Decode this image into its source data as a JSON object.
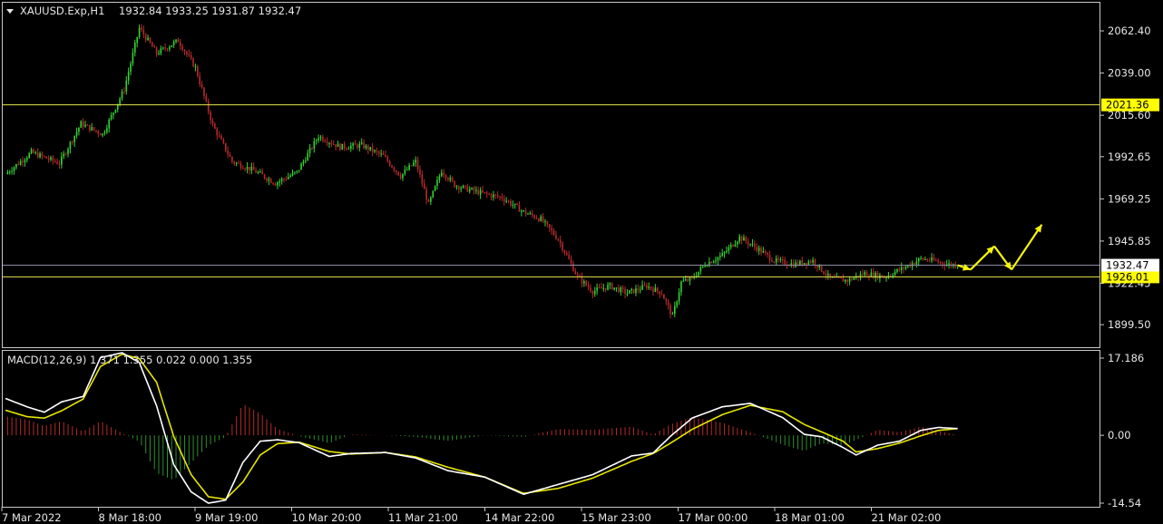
{
  "header": {
    "dropdown_icon": "triangle-down-icon",
    "symbol": "XAUUSD.Exp,H1",
    "ohlc": "1932.84 1933.25 1931.87 1932.47"
  },
  "macd": {
    "label": "MACD(12,26,9) 1.371 1.355 0.022 0.000 1.355"
  },
  "colors": {
    "background": "#000000",
    "frame": "#c8c8c8",
    "bull_candle": "#35d335",
    "bear_candle": "#b52a2a",
    "level_line": "#e6e64d",
    "level_label_bg": "#ffff00",
    "price_line": "#8a8aa0",
    "macd_line": "#ffffff",
    "signal_line": "#e6e600",
    "forecast_arrow": "#f5f50a"
  },
  "chart_data": [
    {
      "type": "candlestick",
      "symbol": "XAUUSD.Exp",
      "timeframe": "H1",
      "ylim": [
        1887,
        2078
      ],
      "y_ticks": [
        "2062.40",
        "2039.00",
        "2015.60",
        "1992.65",
        "1969.25",
        "1945.85",
        "1922.45",
        "1899.50"
      ],
      "x_ticks": [
        "7 Mar 2022",
        "8 Mar 18:00",
        "9 Mar 19:00",
        "10 Mar 20:00",
        "11 Mar 21:00",
        "14 Mar 22:00",
        "15 Mar 23:00",
        "17 Mar 00:00",
        "18 Mar 01:00",
        "21 Mar 02:00"
      ],
      "close_path": [
        [
          0,
          1983
        ],
        [
          12,
          1995
        ],
        [
          25,
          1989
        ],
        [
          35,
          2011
        ],
        [
          45,
          2005
        ],
        [
          55,
          2030
        ],
        [
          62,
          2064
        ],
        [
          70,
          2050
        ],
        [
          80,
          2057
        ],
        [
          88,
          2042
        ],
        [
          96,
          2010
        ],
        [
          105,
          1990
        ],
        [
          115,
          1985
        ],
        [
          125,
          1978
        ],
        [
          135,
          1984
        ],
        [
          145,
          2004
        ],
        [
          155,
          1998
        ],
        [
          165,
          1999
        ],
        [
          175,
          1993
        ],
        [
          183,
          1982
        ],
        [
          190,
          1990
        ],
        [
          196,
          1966
        ],
        [
          202,
          1985
        ],
        [
          208,
          1977
        ],
        [
          213,
          1975
        ],
        [
          222,
          1972
        ],
        [
          230,
          1970
        ],
        [
          240,
          1962
        ],
        [
          248,
          1958
        ],
        [
          256,
          1947
        ],
        [
          265,
          1926
        ],
        [
          272,
          1918
        ],
        [
          280,
          1921
        ],
        [
          288,
          1917
        ],
        [
          297,
          1921
        ],
        [
          304,
          1917
        ],
        [
          309,
          1904
        ],
        [
          313,
          1923
        ],
        [
          318,
          1925
        ],
        [
          324,
          1933
        ],
        [
          332,
          1938
        ],
        [
          340,
          1948
        ],
        [
          348,
          1942
        ],
        [
          356,
          1935
        ],
        [
          365,
          1933
        ],
        [
          374,
          1935
        ],
        [
          382,
          1925
        ],
        [
          390,
          1924
        ],
        [
          398,
          1928
        ],
        [
          407,
          1926
        ],
        [
          416,
          1931
        ],
        [
          424,
          1936
        ],
        [
          430,
          1935
        ],
        [
          436,
          1933
        ],
        [
          441,
          1932.5
        ]
      ],
      "support_levels": [
        "2021.36",
        "1926.01"
      ],
      "current_price": "1932.47",
      "forecast_path": [
        [
          441,
          1932.5
        ],
        [
          447,
          1930
        ],
        [
          458,
          1943
        ],
        [
          466,
          1930
        ],
        [
          480,
          1955
        ]
      ]
    },
    {
      "type": "line",
      "indicator": "MACD",
      "params": [
        12,
        26,
        9
      ],
      "ylim": [
        -14.54,
        17.186
      ],
      "y_ticks": [
        "17.186",
        "0.00",
        "-14.54"
      ],
      "series": [
        {
          "role": "macd",
          "values": [
            [
              0,
              7.5
            ],
            [
              10,
              5.8
            ],
            [
              18,
              4.7
            ],
            [
              26,
              6.8
            ],
            [
              36,
              7.9
            ],
            [
              44,
              15.8
            ],
            [
              54,
              16.8
            ],
            [
              62,
              14.8
            ],
            [
              70,
              6.0
            ],
            [
              78,
              -6.0
            ],
            [
              86,
              -11.5
            ],
            [
              94,
              -13.8
            ],
            [
              102,
              -13.2
            ],
            [
              110,
              -5.5
            ],
            [
              118,
              -1.2
            ],
            [
              126,
              -0.9
            ],
            [
              136,
              -1.5
            ],
            [
              150,
              -4.3
            ],
            [
              160,
              -3.7
            ],
            [
              176,
              -3.5
            ],
            [
              190,
              -4.6
            ],
            [
              205,
              -7.2
            ],
            [
              222,
              -8.5
            ],
            [
              240,
              -12.0
            ],
            [
              256,
              -10.0
            ],
            [
              272,
              -8.0
            ],
            [
              290,
              -4.2
            ],
            [
              300,
              -3.6
            ],
            [
              308,
              -0.2
            ],
            [
              318,
              3.5
            ],
            [
              332,
              5.8
            ],
            [
              345,
              6.5
            ],
            [
              360,
              3.6
            ],
            [
              370,
              0.2
            ],
            [
              378,
              -0.3
            ],
            [
              388,
              -2.5
            ],
            [
              394,
              -4.0
            ],
            [
              404,
              -2.0
            ],
            [
              414,
              -1.2
            ],
            [
              424,
              1.0
            ],
            [
              432,
              1.6
            ],
            [
              441,
              1.37
            ]
          ]
        },
        {
          "role": "signal",
          "values": [
            [
              0,
              5.1
            ],
            [
              10,
              3.8
            ],
            [
              18,
              3.5
            ],
            [
              26,
              5.0
            ],
            [
              36,
              7.4
            ],
            [
              44,
              14.0
            ],
            [
              54,
              16.5
            ],
            [
              62,
              15.6
            ],
            [
              70,
              10.8
            ],
            [
              78,
              -0.3
            ],
            [
              86,
              -8.0
            ],
            [
              94,
              -12.5
            ],
            [
              102,
              -13.0
            ],
            [
              110,
              -9.5
            ],
            [
              118,
              -4.0
            ],
            [
              126,
              -1.7
            ],
            [
              136,
              -1.4
            ],
            [
              150,
              -3.3
            ],
            [
              160,
              -3.8
            ],
            [
              176,
              -3.5
            ],
            [
              190,
              -4.4
            ],
            [
              205,
              -6.5
            ],
            [
              222,
              -8.5
            ],
            [
              240,
              -11.8
            ],
            [
              256,
              -10.8
            ],
            [
              272,
              -8.7
            ],
            [
              290,
              -5.3
            ],
            [
              300,
              -3.7
            ],
            [
              308,
              -1.6
            ],
            [
              318,
              1.2
            ],
            [
              332,
              4.2
            ],
            [
              345,
              6.1
            ],
            [
              360,
              4.8
            ],
            [
              370,
              2.2
            ],
            [
              378,
              0.7
            ],
            [
              388,
              -1.2
            ],
            [
              394,
              -3.4
            ],
            [
              404,
              -2.7
            ],
            [
              414,
              -1.6
            ],
            [
              424,
              -0.1
            ],
            [
              432,
              1.0
            ],
            [
              441,
              1.36
            ]
          ]
        }
      ]
    }
  ]
}
